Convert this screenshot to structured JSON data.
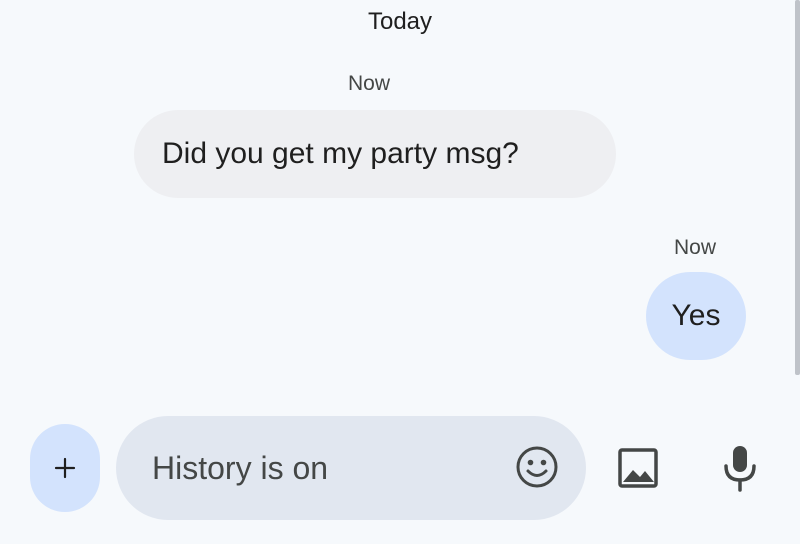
{
  "conversation": {
    "date_header": "Today",
    "messages": [
      {
        "direction": "incoming",
        "timestamp": "Now",
        "text": "Did you get my party msg?"
      },
      {
        "direction": "outgoing",
        "timestamp": "Now",
        "text": "Yes"
      }
    ]
  },
  "composer": {
    "placeholder": "History is on",
    "value": ""
  },
  "icons": {
    "attach": "plus-icon",
    "emoji": "emoji-icon",
    "gallery": "image-icon",
    "voice": "microphone-icon"
  },
  "colors": {
    "background": "#f6f9fc",
    "incoming_bubble": "#eeeff2",
    "outgoing_bubble": "#d3e3fd",
    "composer_field": "#e1e7f0",
    "icon": "#444746"
  }
}
